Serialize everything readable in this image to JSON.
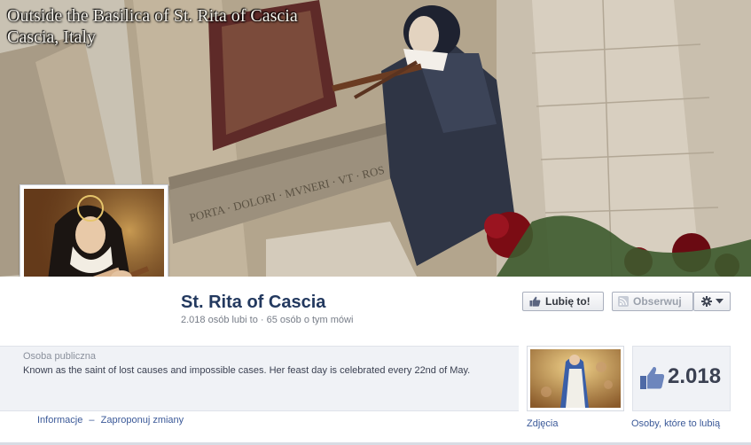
{
  "cover": {
    "caption_line1": "Outside the Basilica of St. Rita of Cascia",
    "caption_line2": "Cascia, Italy"
  },
  "page": {
    "name": "St. Rita of Cascia",
    "stats": "2.018 osób lubi to · 65 osób o tym mówi"
  },
  "actions": {
    "like_label": "Lubię to!",
    "follow_label": "Obserwuj",
    "like_icon": "thumbs-up-icon",
    "follow_icon": "rss-icon",
    "settings_icon": "gear-icon"
  },
  "about": {
    "category": "Osoba publiczna",
    "description": "Known as the saint of lost causes and impossible cases. Her feast day is celebrated every 22nd of May.",
    "link_info": "Informacje",
    "link_separator": "–",
    "link_suggest": "Zaproponuj zmiany"
  },
  "apps": {
    "photos_label": "Zdjęcia",
    "likes_count": "2.018",
    "likes_label": "Osoby, które to lubią"
  },
  "colors": {
    "name": "#23395f",
    "link": "#3b5998",
    "panel": "#f0f2f6"
  }
}
